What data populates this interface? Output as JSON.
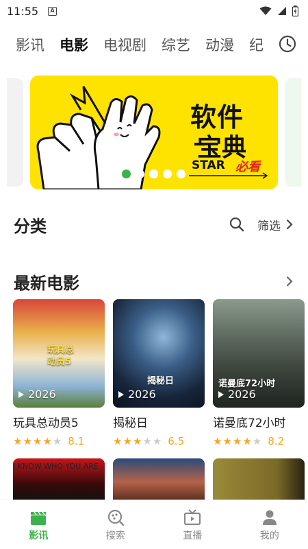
{
  "status_bar": {
    "time": "11:55",
    "app_badge": "A",
    "icons": [
      "wifi-icon",
      "signal-icon",
      "battery-icon"
    ]
  },
  "tabs": {
    "items": [
      {
        "label": "影讯",
        "active": false
      },
      {
        "label": "电影",
        "active": true
      },
      {
        "label": "电视剧",
        "active": false
      },
      {
        "label": "综艺",
        "active": false
      },
      {
        "label": "动漫",
        "active": false
      },
      {
        "label": "纪",
        "active": false
      }
    ],
    "history_icon": "clock-icon"
  },
  "banner": {
    "title": "软件",
    "subtitle": "宝典",
    "star_text": "STAR",
    "must_text": "必看",
    "background": "#ffe300",
    "dots_count": 5,
    "active_dot": 0
  },
  "categories": {
    "title": "分类",
    "filter_label": "筛选"
  },
  "latest": {
    "title": "最新电影",
    "movies": [
      {
        "name": "玩具总动员5",
        "year": "2026",
        "rating": 8.1,
        "stars_on": 4,
        "poster_text": "玩具总动员5"
      },
      {
        "name": "揭秘日",
        "year": "2026",
        "rating": 6.5,
        "stars_on": 3,
        "poster_text": "揭秘日"
      },
      {
        "name": "诺曼底72小时",
        "year": "2026",
        "rating": 8.2,
        "stars_on": 4,
        "poster_text": "诺曼底72小时"
      }
    ],
    "second_row_text": [
      "I KNOW WHO YOU ARE",
      "",
      ""
    ]
  },
  "bottom_nav": {
    "items": [
      {
        "label": "影讯",
        "icon": "clapperboard-icon",
        "active": true
      },
      {
        "label": "搜索",
        "icon": "search-film-icon",
        "active": false
      },
      {
        "label": "直播",
        "icon": "tv-icon",
        "active": false
      },
      {
        "label": "我的",
        "icon": "user-icon",
        "active": false
      }
    ]
  },
  "colors": {
    "accent": "#3bb34a",
    "star": "#f5a623",
    "banner_red": "#e0231b"
  }
}
